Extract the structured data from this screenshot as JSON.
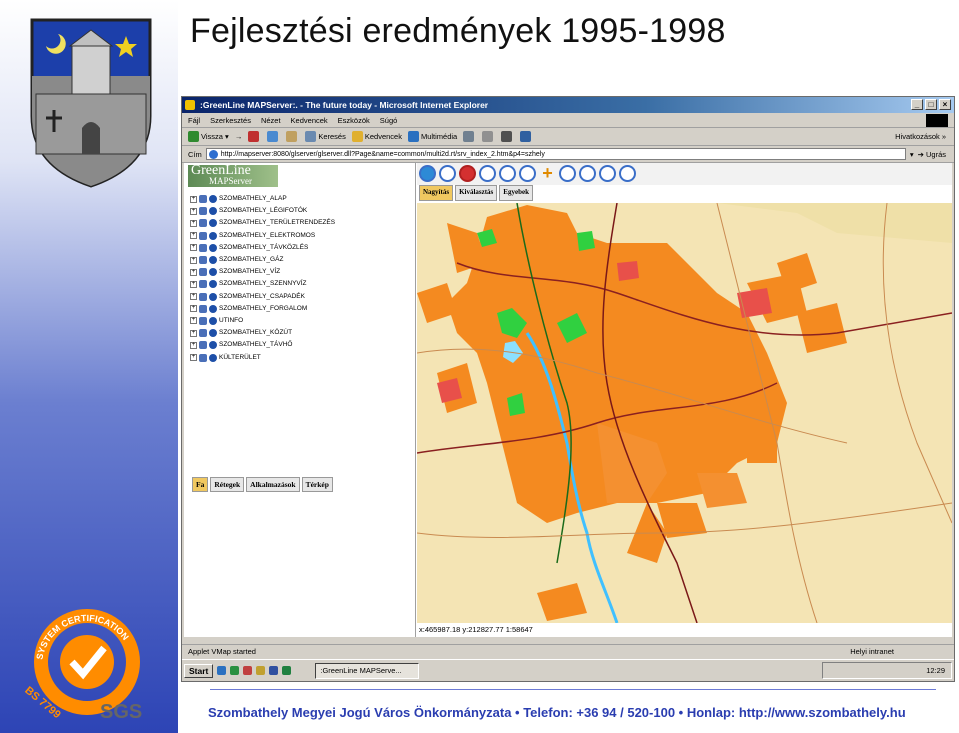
{
  "slide": {
    "title": "Fejlesztési eredmények 1995-1998",
    "footer": "Szombathely Megyei Jogú Város Önkormányzata • Telefon: +36 94 / 520-100 • Honlap: http://www.szombathely.hu"
  },
  "certification": {
    "ring_text": "SYSTEM CERTIFICATION",
    "standard": "BS 7799",
    "brand": "SGS"
  },
  "browser": {
    "title": ":GreenLine MAPServer:. - The future today - Microsoft Internet Explorer",
    "menu": [
      "Fájl",
      "Szerkesztés",
      "Nézet",
      "Kedvencek",
      "Eszközök",
      "Súgó"
    ],
    "toolbar": {
      "back": "Vissza",
      "search": "Keresés",
      "favorites": "Kedvencek",
      "media": "Multimédia",
      "links": "Hivatkozások »"
    },
    "address_label": "Cím",
    "address": "http://mapserver:8080/glserver/glserver.dll?Page&name=common/multi2d.rt/srv_index_2.htm&p4=szhely",
    "go": "Ugrás",
    "status": "Applet VMap started",
    "zone": "Helyi intranet"
  },
  "app": {
    "brand_line1": "GreenLine",
    "brand_line2": "MAPServer",
    "layers": [
      "SZOMBATHELY_ALAP",
      "SZOMBATHELY_LÉGIFOTÓK",
      "SZOMBATHELY_TERÜLETRENDEZÉS",
      "SZOMBATHELY_ELEKTROMOS",
      "SZOMBATHELY_TÁVKÖZLÉS",
      "SZOMBATHELY_GÁZ",
      "SZOMBATHELY_VÍZ",
      "SZOMBATHELY_SZENNYVÍZ",
      "SZOMBATHELY_CSAPADÉK",
      "SZOMBATHELY_FORGALOM",
      "UTINFO",
      "SZOMBATHELY_KÖZÚT",
      "SZOMBATHELY_TÁVHŐ",
      "KÜLTERÜLET"
    ],
    "left_tabs": [
      "Fa",
      "Rétegek",
      "Alkalmazások",
      "Térkép"
    ],
    "map_tabs": [
      "Nagyítás",
      "Kiválasztás",
      "Egyebek"
    ],
    "coords": "x:465987.18 y:212827.77   1:58647"
  },
  "taskbar": {
    "start": "Start",
    "task": ":GreenLine MAPServe...",
    "clock": "12:29"
  }
}
